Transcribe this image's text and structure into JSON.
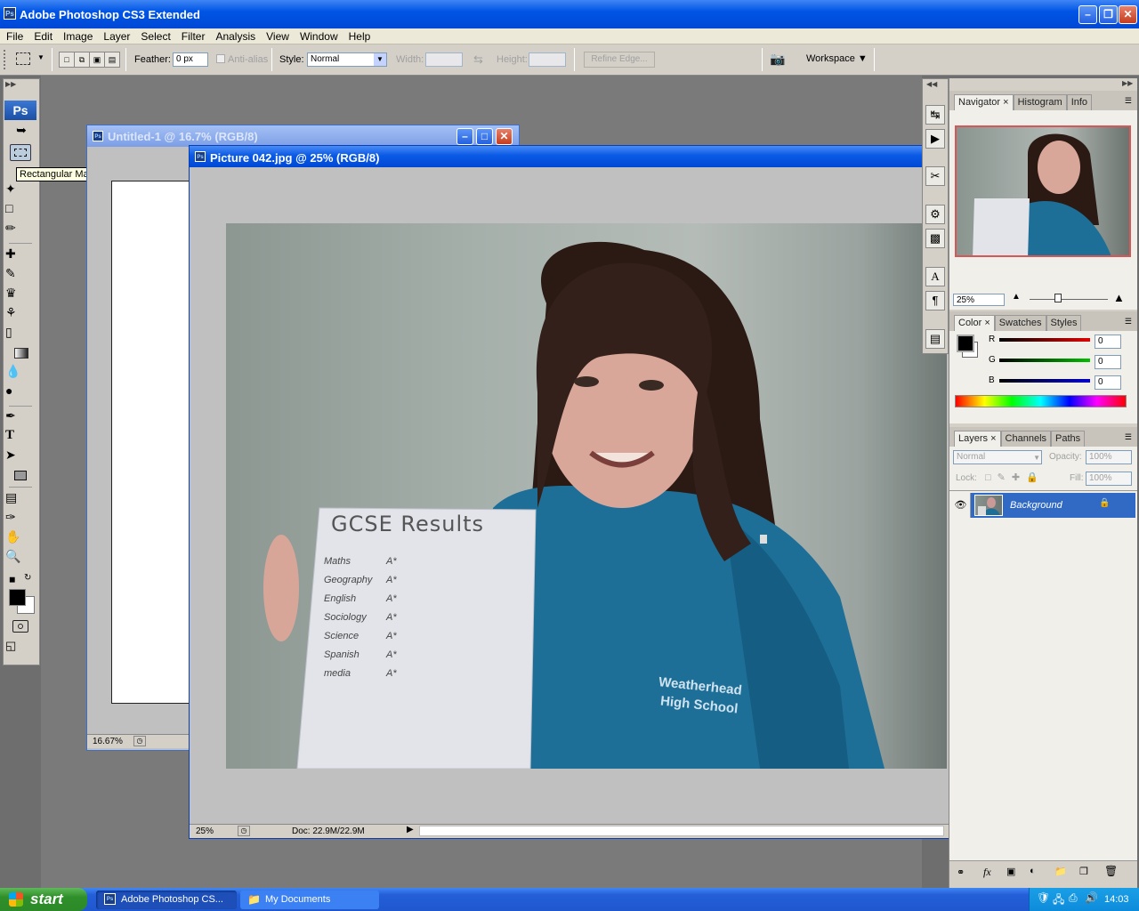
{
  "app": {
    "title": "Adobe Photoshop CS3 Extended",
    "logo_text": "Ps"
  },
  "menu": [
    "File",
    "Edit",
    "Image",
    "Layer",
    "Select",
    "Filter",
    "Analysis",
    "View",
    "Window",
    "Help"
  ],
  "options": {
    "feather_label": "Feather:",
    "feather_value": "0 px",
    "antialias_label": "Anti-alias",
    "style_label": "Style:",
    "style_value": "Normal",
    "width_label": "Width:",
    "height_label": "Height:",
    "refine_edge": "Refine Edge...",
    "workspace_label": "Workspace"
  },
  "tooltip": "Rectangular Marquee Tool (M)",
  "documents": {
    "untitled": {
      "title": "Untitled-1 @ 16.7% (RGB/8)",
      "zoom": "16.67%"
    },
    "picture": {
      "title": "Picture 042.jpg @ 25% (RGB/8)",
      "zoom": "25%",
      "doc_info": "Doc: 22.9M/22.9M"
    }
  },
  "photo": {
    "paper_title": "GCSE Results",
    "results": [
      {
        "subject": "Maths",
        "grade": "A*"
      },
      {
        "subject": "Geography",
        "grade": "A*"
      },
      {
        "subject": "English",
        "grade": "A*"
      },
      {
        "subject": "Sociology",
        "grade": "A*"
      },
      {
        "subject": "Science",
        "grade": "A*"
      },
      {
        "subject": "Spanish",
        "grade": "A*"
      },
      {
        "subject": "media",
        "grade": "A*"
      }
    ],
    "hoodie_line1": "Weatherhead",
    "hoodie_line2": "High School"
  },
  "navigator": {
    "tabs": [
      "Navigator",
      "Histogram",
      "Info"
    ],
    "zoom": "25%"
  },
  "color_panel": {
    "tabs": [
      "Color",
      "Swatches",
      "Styles"
    ],
    "r_label": "R",
    "g_label": "G",
    "b_label": "B",
    "r": "0",
    "g": "0",
    "b": "0",
    "slider_colors": {
      "r": "#e00000",
      "g": "#00c000",
      "b": "#0000d0"
    }
  },
  "layers_panel": {
    "tabs": [
      "Layers",
      "Channels",
      "Paths"
    ],
    "blend_mode": "Normal",
    "opacity_label": "Opacity:",
    "opacity": "100%",
    "lock_label": "Lock:",
    "fill_label": "Fill:",
    "fill": "100%",
    "layer_name": "Background"
  },
  "taskbar": {
    "start_label": "start",
    "items": [
      "Adobe Photoshop CS...",
      "My Documents"
    ],
    "clock": "14:03"
  },
  "colors": {
    "xp_blue": "#0055e5",
    "panel_gray": "#d4d0c8",
    "selected_layer": "#316ac5"
  }
}
